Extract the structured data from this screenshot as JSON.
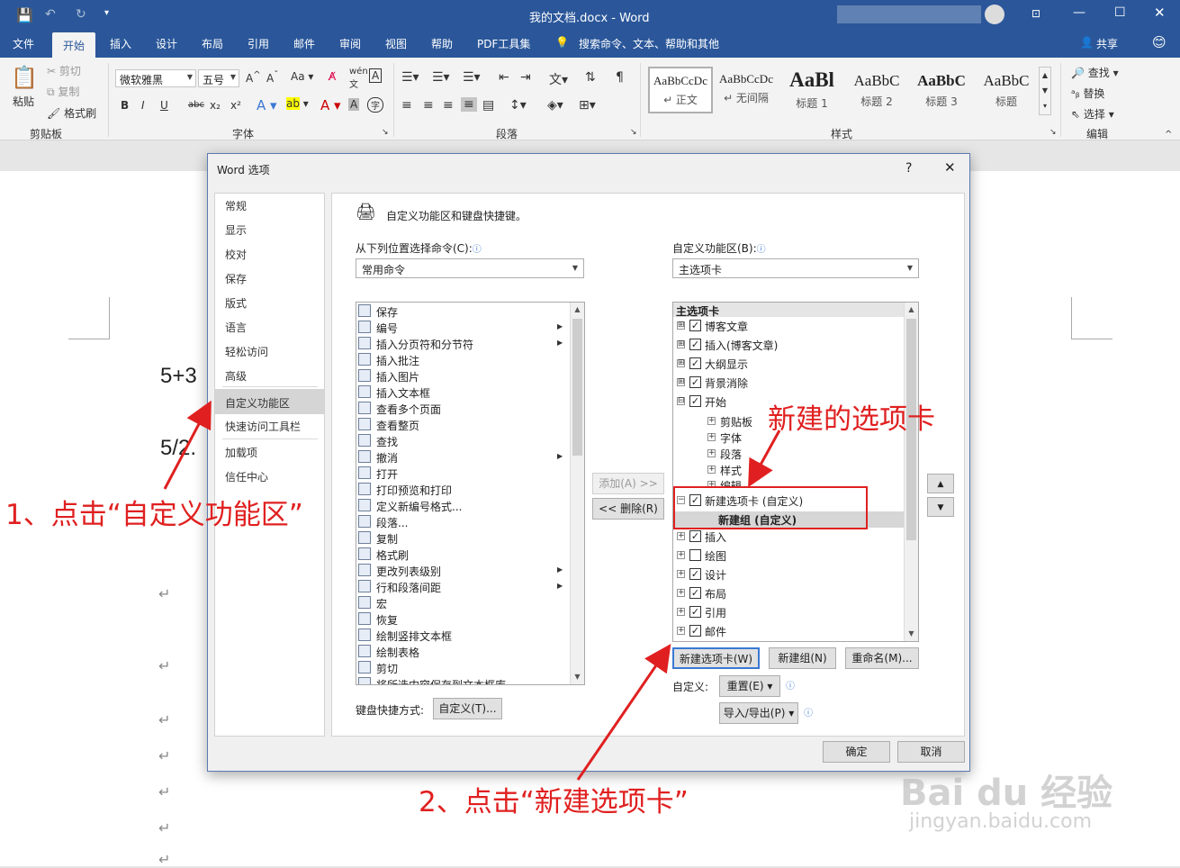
{
  "titlebar": {
    "title": "我的文档.docx - Word",
    "search_hint": "搜索命令、文本、帮助和其他",
    "share": "共享"
  },
  "tabs": [
    "文件",
    "开始",
    "插入",
    "设计",
    "布局",
    "引用",
    "邮件",
    "审阅",
    "视图",
    "帮助",
    "PDF工具集"
  ],
  "ribbon": {
    "clipboard": {
      "paste": "粘贴",
      "cut": "剪切",
      "copy": "复制",
      "format_painter": "格式刷",
      "label": "剪贴板"
    },
    "font": {
      "name": "微软雅黑",
      "size": "五号",
      "label": "字体",
      "bold": "B",
      "italic": "I",
      "underline": "U",
      "strike": "abc",
      "sub": "x₂",
      "sup": "x²"
    },
    "paragraph": {
      "label": "段落"
    },
    "styles": {
      "label": "样式",
      "items": [
        {
          "preview": "AaBbCcDc",
          "name": "↵ 正文"
        },
        {
          "preview": "AaBbCcDc",
          "name": "↵ 无间隔"
        },
        {
          "preview": "AaBl",
          "name": "标题 1"
        },
        {
          "preview": "AaBbC",
          "name": "标题 2"
        },
        {
          "preview": "AaBbC",
          "name": "标题 3"
        },
        {
          "preview": "AaBbC",
          "name": "标题"
        }
      ]
    },
    "editing": {
      "find": "查找",
      "replace": "替换",
      "select": "选择",
      "label": "编辑"
    }
  },
  "document": {
    "line1": "5+3",
    "line2": "5/2."
  },
  "dialog": {
    "title": "Word 选项",
    "help": "?",
    "close": "✕",
    "nav": [
      "常规",
      "显示",
      "校对",
      "保存",
      "版式",
      "语言",
      "轻松访问",
      "高级",
      "自定义功能区",
      "快速访问工具栏",
      "加载项",
      "信任中心"
    ],
    "header": "自定义功能区和键盘快捷键。",
    "choose_label": "从下列位置选择命令(C):",
    "choose_value": "常用命令",
    "customize_label": "自定义功能区(B):",
    "customize_value": "主选项卡",
    "commands": [
      "保存",
      "编号",
      "插入分页符和分节符",
      "插入批注",
      "插入图片",
      "插入文本框",
      "查看多个页面",
      "查看整页",
      "查找",
      "撤消",
      "打开",
      "打印预览和打印",
      "定义新编号格式...",
      "段落...",
      "复制",
      "格式刷",
      "更改列表级别",
      "行和段落间距",
      "宏",
      "恢复",
      "绘制竖排文本框",
      "绘制表格",
      "剪切",
      "将所选内容保存到文本框库"
    ],
    "tree_header": "主选项卡",
    "tree": [
      {
        "exp": "⊞",
        "check": true,
        "label": "博客文章"
      },
      {
        "exp": "⊞",
        "check": true,
        "label": "插入(博客文章)"
      },
      {
        "exp": "⊞",
        "check": true,
        "label": "大纲显示"
      },
      {
        "exp": "⊞",
        "check": true,
        "label": "背景消除"
      },
      {
        "exp": "⊟",
        "check": true,
        "label": "开始"
      }
    ],
    "tree_groups": [
      "剪贴板",
      "字体",
      "段落",
      "样式",
      "编辑"
    ],
    "new_tab": "新建选项卡 (自定义)",
    "new_group": "新建组 (自定义)",
    "tree2": [
      {
        "check": true,
        "label": "插入"
      },
      {
        "check": false,
        "label": "绘图"
      },
      {
        "check": true,
        "label": "设计"
      },
      {
        "check": true,
        "label": "布局"
      },
      {
        "check": true,
        "label": "引用"
      },
      {
        "check": true,
        "label": "邮件"
      }
    ],
    "add_btn": "添加(A) >>",
    "remove_btn": "<< 删除(R)",
    "new_tab_btn": "新建选项卡(W)",
    "new_group_btn": "新建组(N)",
    "rename_btn": "重命名(M)...",
    "customize_lbl": "自定义:",
    "reset_btn": "重置(E) ▾",
    "import_btn": "导入/导出(P) ▾",
    "kbd_label": "键盘快捷方式:",
    "kbd_btn": "自定义(T)...",
    "ok": "确定",
    "cancel": "取消"
  },
  "annotations": {
    "a1": "1、点击“自定义功能区”",
    "a2": "2、点击“新建选项卡”",
    "a3": "新建的选项卡"
  },
  "watermark": {
    "main": "Bai du 经验",
    "sub": "jingyan.baidu.com"
  },
  "colors": {
    "accent": "#2b579a",
    "annotation": "#e02020"
  }
}
